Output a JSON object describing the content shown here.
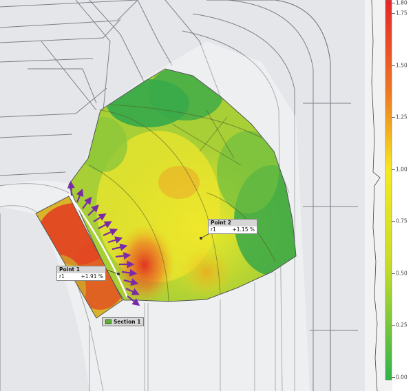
{
  "legend": {
    "ticks": [
      "1.80",
      "1.75",
      "1.50",
      "1.25",
      "1.00",
      "0.75",
      "0.50",
      "0.25",
      "0.00"
    ],
    "tick_values": [
      1.8,
      1.75,
      1.5,
      1.25,
      1.0,
      0.75,
      0.5,
      0.25,
      0.0
    ],
    "range": [
      0.0,
      1.8
    ],
    "colors": {
      "high": "#e4252a",
      "mid": "#f6ea1f",
      "low": "#2eb34a"
    }
  },
  "annotations": {
    "point1": {
      "title": "Point 1",
      "var": "r1",
      "value": "+1.91 %"
    },
    "point2": {
      "title": "Point 2",
      "var": "r1",
      "value": "+1.15 %"
    },
    "section": {
      "label": "Section 1"
    }
  }
}
